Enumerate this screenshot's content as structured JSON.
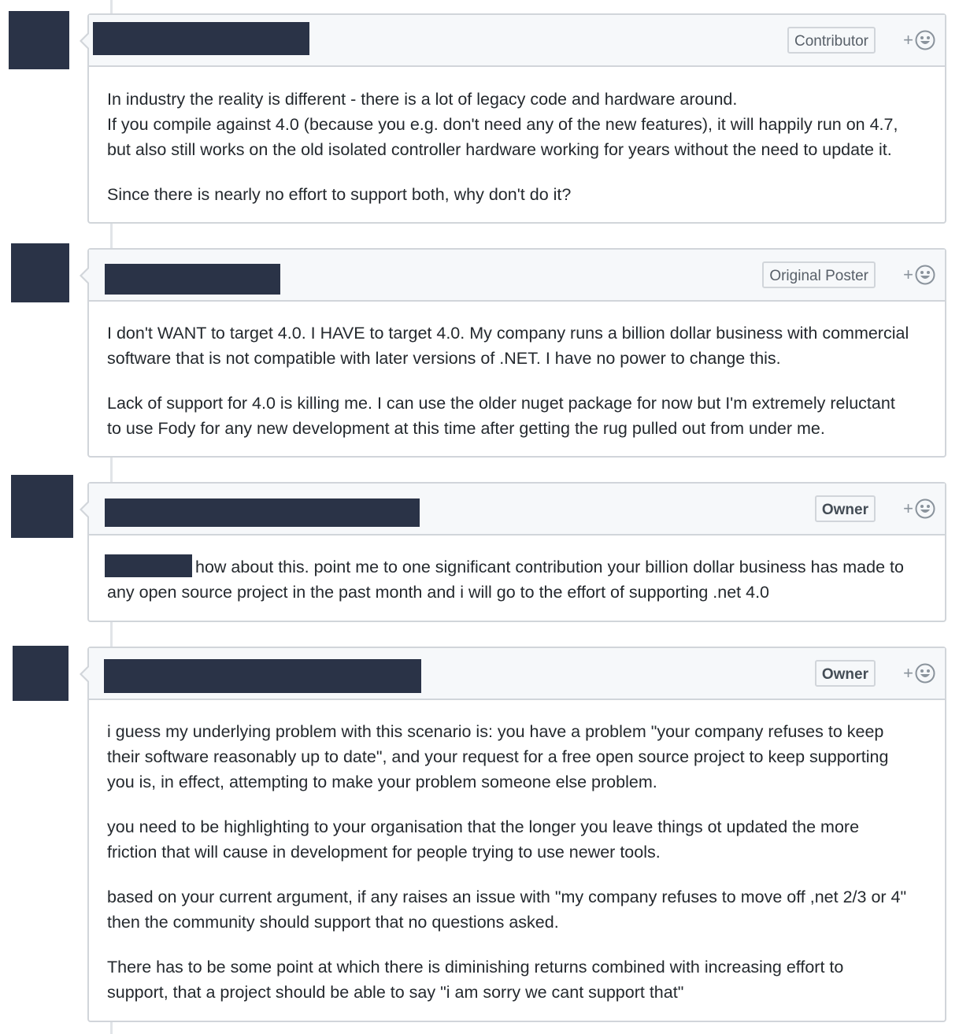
{
  "comments": [
    {
      "role": "Contributor",
      "paragraphs": [
        [
          "In industry the reality is different - there is a lot of legacy code and hardware around.",
          "If you compile against 4.0 (because you e.g. don't need any of the new features), it will happily run on 4.7,",
          "but also still works on the old isolated controller hardware working for years without the need to update it."
        ],
        [
          "Since there is nearly no effort to support both, why don't do it?"
        ]
      ]
    },
    {
      "role": "Original Poster",
      "paragraphs": [
        [
          "I don't WANT to target 4.0. I HAVE to target 4.0. My company runs a billion dollar business with commercial",
          "software that is not compatible with later versions of .NET. I have no power to change this."
        ],
        [
          "Lack of support for 4.0 is killing me. I can use the older nuget package for now but I'm extremely reluctant",
          "to use Fody for any new development at this time after getting the rug pulled out from under me."
        ]
      ]
    },
    {
      "role": "Owner",
      "paragraphs": [
        [
          "how about this. point me to one significant contribution your billion dollar business has made to",
          "any open source project in the past month and i will go to the effort of supporting .net 4.0"
        ]
      ]
    },
    {
      "role": "Owner",
      "paragraphs": [
        [
          "i guess my underlying problem with this scenario is: you have a problem \"your company refuses to keep",
          "their software reasonably up to date\", and your request for a free open source project to keep supporting",
          "you is, in effect, attempting to make your problem someone else problem."
        ],
        [
          "you need to be highlighting to your organisation that the longer you leave things ot updated the more",
          "friction that will cause in development for people trying to use newer tools."
        ],
        [
          "based on your current argument, if any raises an issue with \"my company refuses to move off ,net 2/3 or 4\"",
          "then the community should support that no questions asked."
        ],
        [
          "There has to be some point at which there is diminishing returns combined with increasing effort to",
          "support, that a project should be able to say \"i am sorry we cant support that\""
        ]
      ]
    }
  ],
  "reaction_label": "+",
  "colors": {
    "redaction": "#2a3347",
    "border": "#d1d5da",
    "header_bg": "#f6f8fa"
  }
}
